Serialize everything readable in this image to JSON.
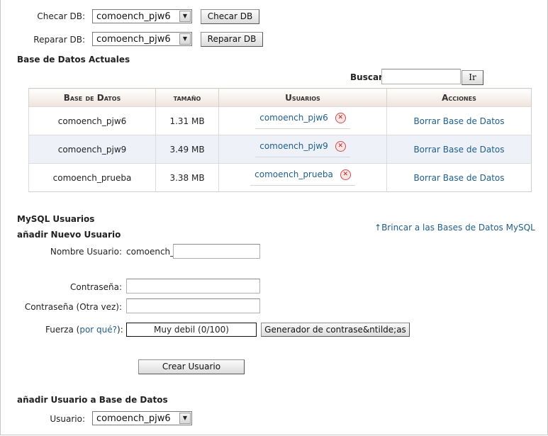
{
  "check": {
    "label": "Checar DB:",
    "selected": "comoench_pjw6",
    "button": "Checar DB"
  },
  "repair": {
    "label": "Reparar DB:",
    "selected": "comoench_pjw6",
    "button": "Reparar DB"
  },
  "databases": {
    "heading": "Base de Datos Actuales",
    "search_label": "Buscar",
    "search_value": "",
    "search_button": "Ir",
    "columns": [
      "Base de Datos",
      "tamaño",
      "Usuarios",
      "Acciones"
    ],
    "rows": [
      {
        "name": "comoench_pjw6",
        "size": "1.31 MB",
        "user": "comoench_pjw6",
        "action": "Borrar Base de Datos"
      },
      {
        "name": "comoench_pjw9",
        "size": "3.49 MB",
        "user": "comoench_pjw9",
        "action": "Borrar Base de Datos"
      },
      {
        "name": "comoench_prueba",
        "size": "3.38 MB",
        "user": "comoench_prueba",
        "action": "Borrar Base de Datos"
      }
    ]
  },
  "users": {
    "heading": "MySQL Usuarios",
    "jump_link": "Brincar a las Bases de Datos MySQL",
    "add_heading": "añadir Nuevo Usuario",
    "username_label": "Nombre Usuario:",
    "username_prefix": "comoench_",
    "password_label": "Contraseña:",
    "password_again_label": "Contraseña (Otra vez):",
    "strength_label_start": "Fuerza (",
    "strength_link": "por qué?",
    "strength_label_end": "):",
    "strength_value": "Muy debil (0/100)",
    "generator_button": "Generador de contrase&ntilde;as",
    "create_button": "Crear Usuario"
  },
  "add_to_db": {
    "heading": "añadir Usuario a Base de Datos",
    "user_label": "Usuario:",
    "user_selected": "comoench_pjw6"
  }
}
